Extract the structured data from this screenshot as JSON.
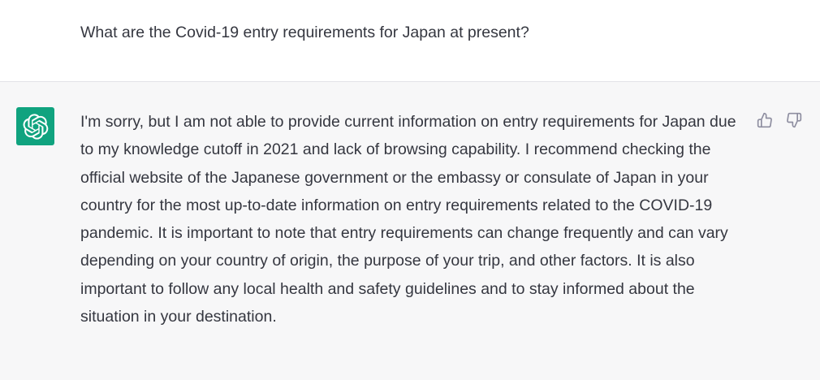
{
  "conversation": {
    "user_message": "What are the Covid-19 entry requirements for Japan at present?",
    "assistant_message": "I'm sorry, but I am not able to provide current information on entry requirements for Japan due to my knowledge cutoff in 2021 and lack of browsing capability. I recommend checking the official website of the Japanese government or the embassy or consulate of Japan in your country for the most up-to-date information on entry requirements related to the COVID-19 pandemic. It is important to note that entry requirements can change frequently and can vary depending on your country of origin, the purpose of your trip, and other factors. It is also important to follow any local health and safety guidelines and to stay informed about the situation in your destination."
  },
  "icons": {
    "avatar": "openai-logo-icon",
    "thumbs_up": "thumbs-up-icon",
    "thumbs_down": "thumbs-down-icon"
  },
  "colors": {
    "avatar_bg": "#10a37f",
    "assistant_bg": "#f7f7f8",
    "text": "#353740",
    "icon": "#8e8ea0"
  }
}
